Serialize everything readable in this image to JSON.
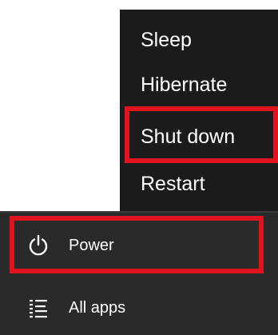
{
  "power_menu": {
    "items": [
      {
        "label": "Sleep"
      },
      {
        "label": "Hibernate"
      },
      {
        "label": "Shut down"
      },
      {
        "label": "Restart"
      }
    ]
  },
  "start_panel": {
    "power": {
      "label": "Power",
      "icon": "power-icon"
    },
    "all_apps": {
      "label": "All apps",
      "icon": "list-icon"
    }
  },
  "colors": {
    "menu_background": "#1b1b1b",
    "panel_background": "#2a2a2a",
    "text": "#ffffff",
    "highlight_outline": "#e0141e"
  }
}
